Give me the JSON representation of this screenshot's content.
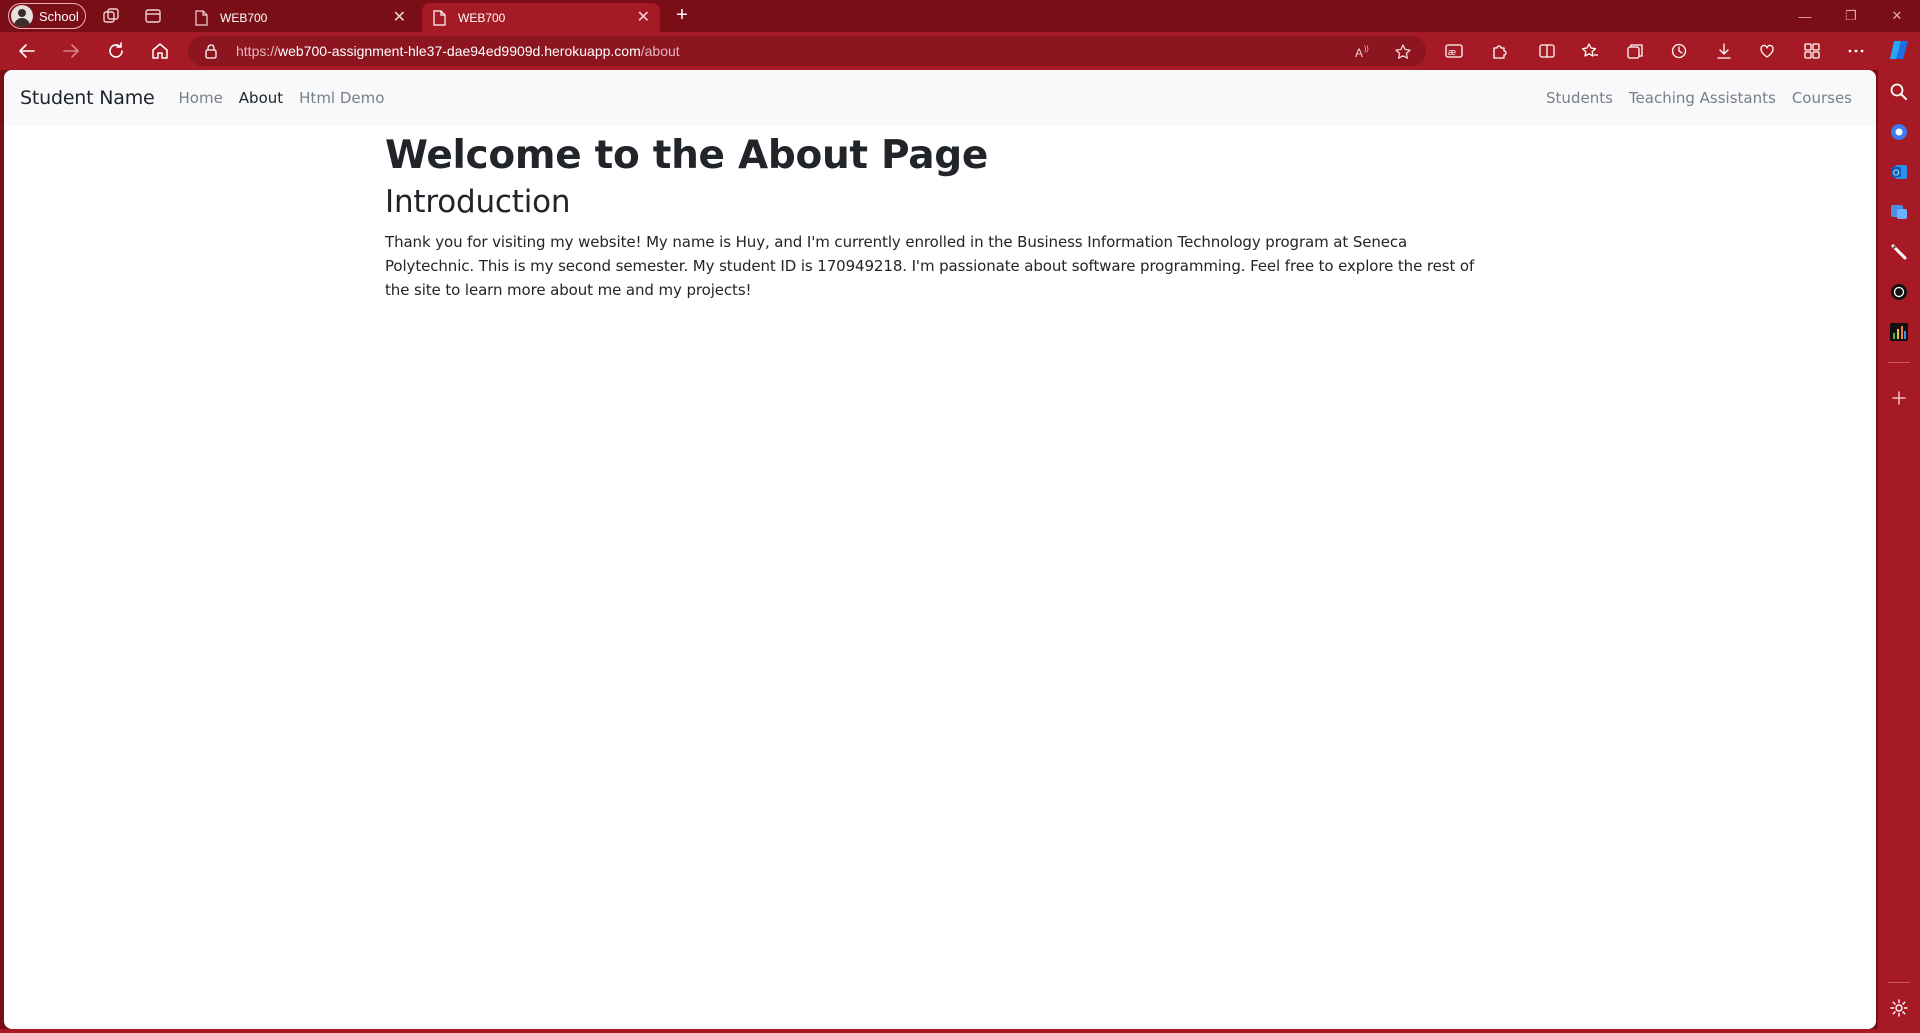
{
  "browser": {
    "profile_label": "School",
    "tabs": [
      {
        "title": "WEB700",
        "active": false
      },
      {
        "title": "WEB700",
        "active": true
      }
    ],
    "address": {
      "prefix": "https://",
      "host": "web700-assignment-hle37-dae94ed9909d.herokuapp.com",
      "path": "/about"
    },
    "window_controls": [
      "minimize",
      "restore",
      "close"
    ],
    "accent_color": "#a51a24",
    "frame_color": "#7a0e16"
  },
  "navbar": {
    "brand": "Student Name",
    "left_links": [
      "Home",
      "About",
      "Html Demo"
    ],
    "active_link": "About",
    "right_links": [
      "Students",
      "Teaching Assistants",
      "Courses"
    ]
  },
  "page": {
    "title": "Welcome to the About Page",
    "subtitle": "Introduction",
    "body": "Thank you for visiting my website! My name is Huy, and I'm currently enrolled in the Business Information Technology program at Seneca Polytechnic. This is my second semester. My student ID is 170949218. I'm passionate about software programming. Feel free to explore the rest of the site to learn more about me and my projects!"
  }
}
